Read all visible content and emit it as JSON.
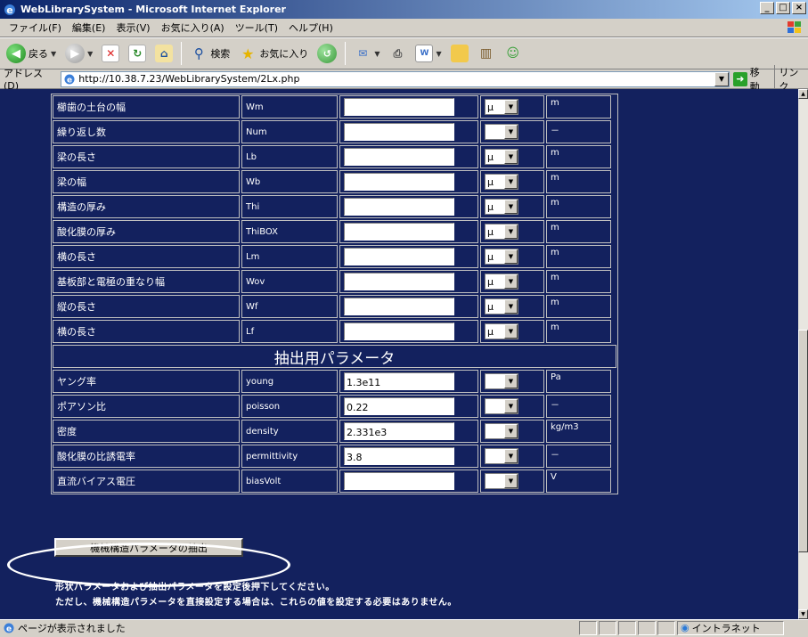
{
  "window": {
    "title": "WebLibrarySystem - Microsoft Internet Explorer"
  },
  "menu": [
    "ファイル(F)",
    "編集(E)",
    "表示(V)",
    "お気に入り(A)",
    "ツール(T)",
    "ヘルプ(H)"
  ],
  "toolbar": {
    "back_label": "戻る",
    "search_label": "検索",
    "favorites_label": "お気に入り"
  },
  "address": {
    "label": "アドレス(D)",
    "url": "http://10.38.7.23/WebLibrarySystem/2Lx.php",
    "go_label": "移動",
    "links_label": "リンク"
  },
  "shape_params": [
    {
      "name": "櫛歯の土台の幅",
      "symbol": "Wm",
      "value": "",
      "unit_prefix": "μ",
      "unit": "m"
    },
    {
      "name": "繰り返し数",
      "symbol": "Num",
      "value": "",
      "unit_prefix": "",
      "unit": "－"
    },
    {
      "name": "梁の長さ",
      "symbol": "Lb",
      "value": "",
      "unit_prefix": "μ",
      "unit": "m"
    },
    {
      "name": "梁の幅",
      "symbol": "Wb",
      "value": "",
      "unit_prefix": "μ",
      "unit": "m"
    },
    {
      "name": "構造の厚み",
      "symbol": "Thi",
      "value": "",
      "unit_prefix": "μ",
      "unit": "m"
    },
    {
      "name": "酸化膜の厚み",
      "symbol": "ThiBOX",
      "value": "",
      "unit_prefix": "μ",
      "unit": "m"
    },
    {
      "name": "横の長さ",
      "symbol": "Lm",
      "value": "",
      "unit_prefix": "μ",
      "unit": "m"
    },
    {
      "name": "基板部と電極の重なり幅",
      "symbol": "Wov",
      "value": "",
      "unit_prefix": "μ",
      "unit": "m"
    },
    {
      "name": "縦の長さ",
      "symbol": "Wf",
      "value": "",
      "unit_prefix": "μ",
      "unit": "m"
    },
    {
      "name": "横の長さ",
      "symbol": "Lf",
      "value": "",
      "unit_prefix": "μ",
      "unit": "m"
    }
  ],
  "extract_section_title": "抽出用パラメータ",
  "extract_params": [
    {
      "name": "ヤング率",
      "symbol": "young",
      "value": "1.3e11",
      "unit_prefix": "",
      "unit": "Pa"
    },
    {
      "name": "ポアソン比",
      "symbol": "poisson",
      "value": "0.22",
      "unit_prefix": "",
      "unit": "－"
    },
    {
      "name": "密度",
      "symbol": "density",
      "value": "2.331e3",
      "unit_prefix": "",
      "unit": "kg/m3"
    },
    {
      "name": "酸化膜の比誘電率",
      "symbol": "permittivity",
      "value": "3.8",
      "unit_prefix": "",
      "unit": "－"
    },
    {
      "name": "直流バイアス電圧",
      "symbol": "biasVolt",
      "value": "",
      "unit_prefix": "",
      "unit": "V"
    }
  ],
  "extract_button_label": "機械構造パラメータの抽出",
  "notes": [
    "形状パラメータおよび抽出パラメータを設定後押下してください。",
    "ただし、機械構造パラメータを直接設定する場合は、これらの値を設定する必要はありません。"
  ],
  "status": {
    "text": "ページが表示されました",
    "zone": "イントラネット"
  }
}
